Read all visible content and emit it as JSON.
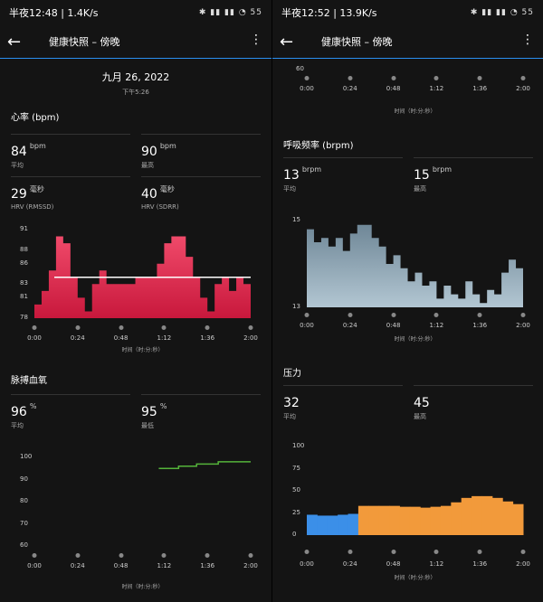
{
  "left": {
    "status": {
      "time": "半夜12:48 | 1.4K/s",
      "icons": "✱ ▮▮ ▮▮ ◔ 55"
    },
    "appbar": {
      "title": "健康快照 – 傍晚"
    },
    "date": "九月 26, 2022",
    "time": "下午5:26",
    "heart": {
      "title": "心率 (bpm)",
      "avg": {
        "value": "84",
        "unit": "bpm",
        "label": "平均"
      },
      "max": {
        "value": "90",
        "unit": "bpm",
        "label": "最高"
      },
      "hrv_rmssd": {
        "value": "29",
        "unit": "毫秒",
        "label": "HRV (RMSSD)"
      },
      "hrv_sdrr": {
        "value": "40",
        "unit": "毫秒",
        "label": "HRV (SDRR)"
      }
    },
    "spo2": {
      "title": "脉搏血氧",
      "avg": {
        "value": "96",
        "unit": "%",
        "label": "平均"
      },
      "min": {
        "value": "95",
        "unit": "%",
        "label": "最低"
      }
    },
    "x_axis_name": "时间（时:分:秒）",
    "x_ticks": [
      "0:00",
      "0:24",
      "0:48",
      "1:12",
      "1:36",
      "2:00"
    ]
  },
  "right": {
    "status": {
      "time": "半夜12:52 | 13.9K/s",
      "icons": "✱ ▮▮ ▮▮ ◔ 55"
    },
    "appbar": {
      "title": "健康快照 – 傍晚"
    },
    "top_axis": {
      "label": "60",
      "name": "时间（时:分:秒）",
      "ticks": [
        "0:00",
        "0:24",
        "0:48",
        "1:12",
        "1:36",
        "2:00"
      ]
    },
    "resp": {
      "title": "呼吸频率 (brpm)",
      "avg": {
        "value": "13",
        "unit": "brpm",
        "label": "平均"
      },
      "max": {
        "value": "15",
        "unit": "brpm",
        "label": "最高"
      }
    },
    "stress": {
      "title": "压力",
      "avg": {
        "value": "32",
        "label": "平均"
      },
      "max": {
        "value": "45",
        "label": "最高"
      }
    },
    "x_axis_name": "时间（时:分:秒）",
    "x_ticks": [
      "0:00",
      "0:24",
      "0:48",
      "1:12",
      "1:36",
      "2:00"
    ]
  },
  "colors": {
    "hr": "#c8183c",
    "spo2": "#54b33a",
    "resp": "#8aa3b4",
    "stress_low": "#3b8fe8",
    "stress_mid": "#f29a3b",
    "accent": "#2a8ff0"
  },
  "chart_data": [
    {
      "type": "area",
      "title": "心率 (bpm)",
      "xlabel": "时间（时:分:秒）",
      "y_ticks": [
        78,
        81,
        83,
        86,
        88,
        91
      ],
      "ylim": [
        78,
        91
      ],
      "x": [
        0,
        4,
        8,
        12,
        16,
        20,
        24,
        28,
        32,
        36,
        40,
        44,
        48,
        52,
        56,
        60,
        64,
        68,
        72,
        76,
        80,
        84,
        88,
        92,
        96,
        100,
        104,
        108,
        112,
        116,
        120
      ],
      "values": [
        80,
        82,
        85,
        90,
        89,
        84,
        81,
        79,
        83,
        85,
        83,
        83,
        83,
        83,
        84,
        84,
        84,
        86,
        89,
        90,
        90,
        87,
        84,
        81,
        79,
        83,
        84,
        82,
        84,
        83,
        83
      ],
      "reference": 84
    },
    {
      "type": "line",
      "title": "脉搏血氧",
      "xlabel": "时间（时:分:秒）",
      "y_ticks": [
        60,
        70,
        80,
        90,
        100
      ],
      "ylim": [
        60,
        100
      ],
      "x": [
        69,
        78,
        80,
        84,
        90,
        96,
        102,
        108,
        114,
        120
      ],
      "values": [
        95,
        95,
        96,
        96,
        97,
        97,
        98,
        98,
        98,
        98
      ]
    },
    {
      "type": "area",
      "title": "呼吸频率 (brpm)",
      "xlabel": "时间（时:分:秒）",
      "y_ticks": [
        13,
        15
      ],
      "ylim": [
        13,
        15
      ],
      "x": [
        0,
        4,
        8,
        12,
        16,
        20,
        24,
        28,
        32,
        36,
        40,
        44,
        48,
        52,
        56,
        60,
        64,
        68,
        72,
        76,
        80,
        84,
        88,
        92,
        96,
        100,
        104,
        108,
        112,
        116,
        120
      ],
      "values": [
        14.8,
        14.5,
        14.6,
        14.4,
        14.6,
        14.3,
        14.7,
        14.9,
        14.9,
        14.6,
        14.4,
        14.0,
        14.2,
        13.9,
        13.6,
        13.8,
        13.5,
        13.6,
        13.2,
        13.5,
        13.3,
        13.2,
        13.6,
        13.3,
        13.1,
        13.4,
        13.3,
        13.8,
        14.1,
        13.9,
        14.5
      ]
    },
    {
      "type": "bar",
      "title": "压力",
      "xlabel": "时间（时:分:秒）",
      "y_ticks": [
        0,
        25,
        50,
        75,
        100
      ],
      "ylim": [
        0,
        100
      ],
      "x": [
        0,
        6,
        12,
        18,
        24,
        30,
        36,
        42,
        48,
        54,
        60,
        66,
        72,
        78,
        84,
        90,
        96,
        102,
        108,
        114,
        120
      ],
      "values": [
        23,
        22,
        22,
        23,
        24,
        33,
        33,
        33,
        33,
        32,
        32,
        31,
        32,
        33,
        37,
        42,
        44,
        44,
        42,
        38,
        35
      ]
    }
  ]
}
